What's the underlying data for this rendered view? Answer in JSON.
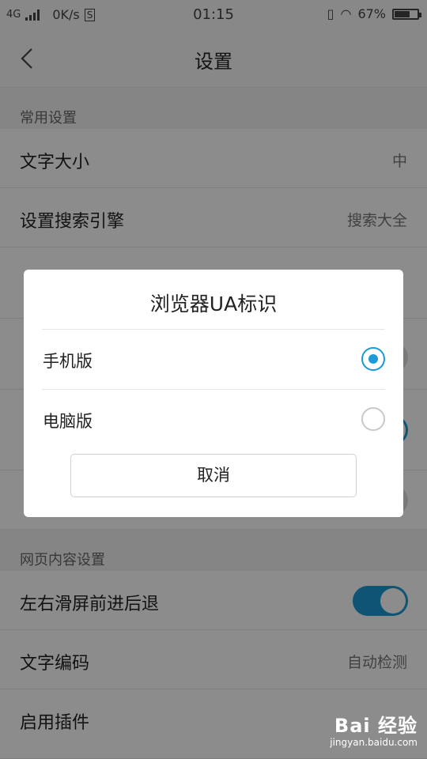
{
  "status_bar": {
    "network": "4G",
    "speed": "0K/s",
    "time": "01:15",
    "battery": "67%",
    "battery_level": 0.67
  },
  "header": {
    "title": "设置"
  },
  "sections": {
    "common": "常用设置",
    "web_content": "网页内容设置"
  },
  "rows": {
    "font_size": {
      "label": "文字大小",
      "value": "中"
    },
    "search_engine": {
      "label": "设置搜索引擎",
      "value": "搜索大全"
    },
    "swipe_nav": {
      "label": "左右滑屏前进后退",
      "toggle": true
    },
    "encoding": {
      "label": "文字编码",
      "value": "自动检测"
    },
    "plugins": {
      "label": "启用插件"
    }
  },
  "dialog": {
    "title": "浏览器UA标识",
    "options": [
      {
        "label": "手机版",
        "checked": true
      },
      {
        "label": "电脑版",
        "checked": false
      }
    ],
    "cancel_label": "取消"
  },
  "watermark": {
    "logo": "Bai 经验",
    "url": "jingyan.baidu.com"
  },
  "colors": {
    "accent": "#1a9ad6",
    "overlay": "rgba(0,0,0,0.45)"
  }
}
